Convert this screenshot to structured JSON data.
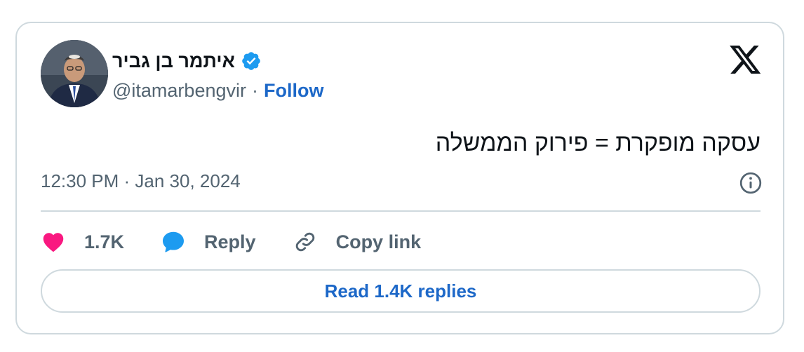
{
  "author": {
    "display_name": "איתמר בן גביר",
    "handle": "@itamarbengvir",
    "separator": "·",
    "follow_label": "Follow",
    "verified_icon": "verified-badge-icon",
    "avatar": "avatar"
  },
  "tweet": {
    "text": "עסקה מופקרת = פירוק הממשלה",
    "timestamp": "12:30 PM · Jan 30, 2024"
  },
  "actions": {
    "likes_count": "1.7K",
    "reply_label": "Reply",
    "copy_link_label": "Copy link"
  },
  "read_replies_label": "Read 1.4K replies",
  "colors": {
    "accent": "#1d68c8",
    "verified": "#1d9bf0",
    "heart": "#f91880",
    "reply_bubble": "#1d9bf0",
    "secondary_text": "#536471",
    "border": "#cfd9de"
  },
  "icons": [
    "x-logo-icon",
    "info-icon",
    "heart-icon",
    "reply-icon",
    "link-icon",
    "verified-badge-icon"
  ]
}
